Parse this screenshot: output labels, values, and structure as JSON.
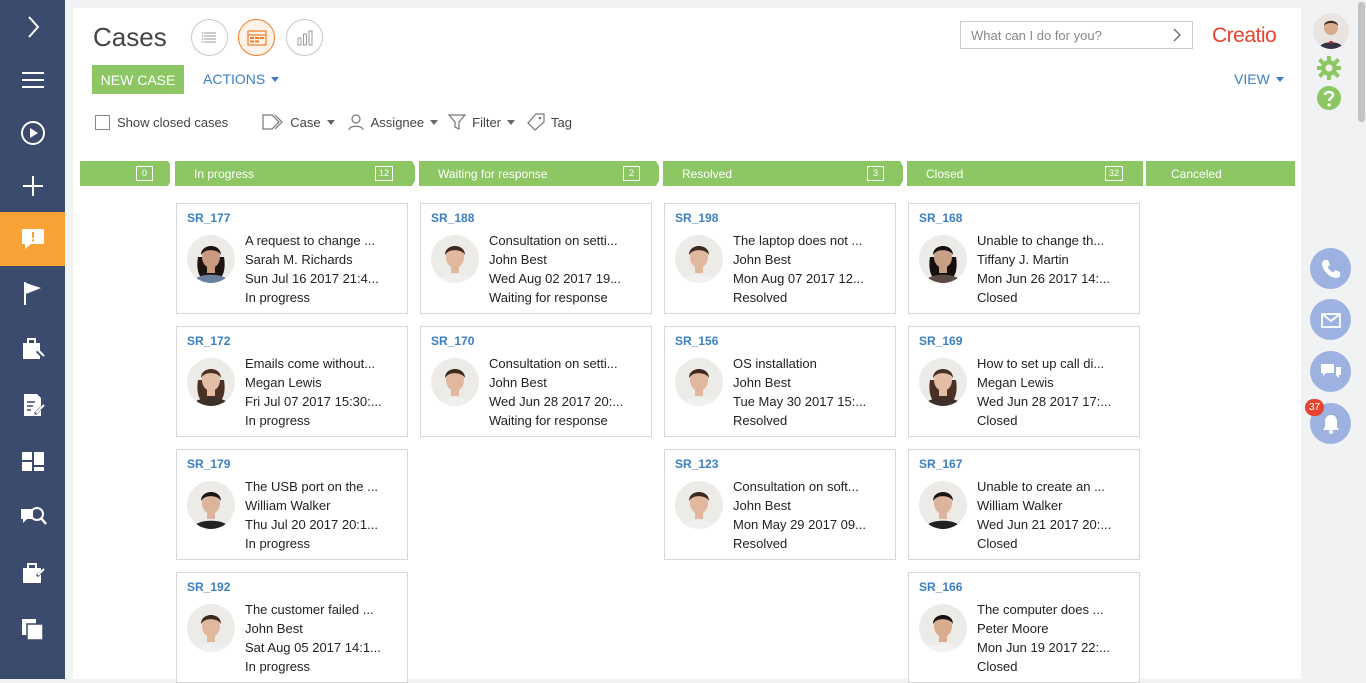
{
  "page": {
    "title": "Cases"
  },
  "header": {
    "search_placeholder": "What can I do for you?",
    "logo": "Creatio",
    "new_case": "NEW CASE",
    "actions": "ACTIONS",
    "view": "VIEW"
  },
  "filters": {
    "show_closed": "Show closed cases",
    "case": "Case",
    "assignee": "Assignee",
    "filter": "Filter",
    "tag": "Tag"
  },
  "stages": [
    {
      "name": "",
      "count": "0"
    },
    {
      "name": "In progress",
      "count": "12"
    },
    {
      "name": "Waiting for response",
      "count": "2"
    },
    {
      "name": "Resolved",
      "count": "3"
    },
    {
      "name": "Closed",
      "count": "32"
    },
    {
      "name": "Canceled",
      "count": ""
    }
  ],
  "columns": [
    [
      {
        "number": "SR_177",
        "subject": "A request to change ...",
        "contact": "Sarah M. Richards",
        "date": "Sun Jul 16 2017 21:4...",
        "status": "In progress"
      },
      {
        "number": "SR_172",
        "subject": "Emails come without...",
        "contact": "Megan Lewis",
        "date": "Fri Jul 07 2017 15:30:...",
        "status": "In progress"
      },
      {
        "number": "SR_179",
        "subject": "The USB port on the ...",
        "contact": "William Walker",
        "date": "Thu Jul 20 2017 20:1...",
        "status": "In progress"
      },
      {
        "number": "SR_192",
        "subject": "The customer failed ...",
        "contact": "John Best",
        "date": "Sat Aug 05 2017 14:1...",
        "status": "In progress"
      }
    ],
    [
      {
        "number": "SR_188",
        "subject": "Consultation on setti...",
        "contact": "John Best",
        "date": "Wed Aug 02 2017 19...",
        "status": "Waiting for response"
      },
      {
        "number": "SR_170",
        "subject": "Consultation on setti...",
        "contact": "John Best",
        "date": "Wed Jun 28 2017 20:...",
        "status": "Waiting for response"
      }
    ],
    [
      {
        "number": "SR_198",
        "subject": "The laptop does not ...",
        "contact": "John Best",
        "date": "Mon Aug 07 2017 12...",
        "status": "Resolved"
      },
      {
        "number": "SR_156",
        "subject": "OS installation",
        "contact": "John Best",
        "date": "Tue May 30 2017 15:...",
        "status": "Resolved"
      },
      {
        "number": "SR_123",
        "subject": "Consultation on soft...",
        "contact": "John Best",
        "date": "Mon May 29 2017 09...",
        "status": "Resolved"
      }
    ],
    [
      {
        "number": "SR_168",
        "subject": "Unable to change th...",
        "contact": "Tiffany J. Martin",
        "date": "Mon Jun 26 2017 14:...",
        "status": "Closed"
      },
      {
        "number": "SR_169",
        "subject": "How to set up call di...",
        "contact": "Megan Lewis",
        "date": "Wed Jun 28 2017 17:...",
        "status": "Closed"
      },
      {
        "number": "SR_167",
        "subject": "Unable to create an ...",
        "contact": "William Walker",
        "date": "Wed Jun 21 2017 20:...",
        "status": "Closed"
      },
      {
        "number": "SR_166",
        "subject": "The computer does ...",
        "contact": "Peter Moore",
        "date": "Mon Jun 19 2017 22:...",
        "status": "Closed"
      }
    ]
  ],
  "notifications": {
    "count": "37"
  },
  "colors": {
    "nav": "#3a4b6e",
    "accent": "#f8a238",
    "stage": "#8dc764",
    "link": "#3a7fc4",
    "brand": "#e8432f"
  },
  "icons": {
    "nav": [
      "expand-icon",
      "menu-icon",
      "play-icon",
      "add-icon",
      "cases-icon",
      "flag-icon",
      "tools-icon",
      "edit-icon",
      "dashboard-icon",
      "knowledge-search-icon",
      "briefcase-icon",
      "files-icon"
    ],
    "right": [
      "gear-icon",
      "help-icon",
      "phone-icon",
      "email-icon",
      "chat-icon",
      "bell-icon"
    ]
  }
}
